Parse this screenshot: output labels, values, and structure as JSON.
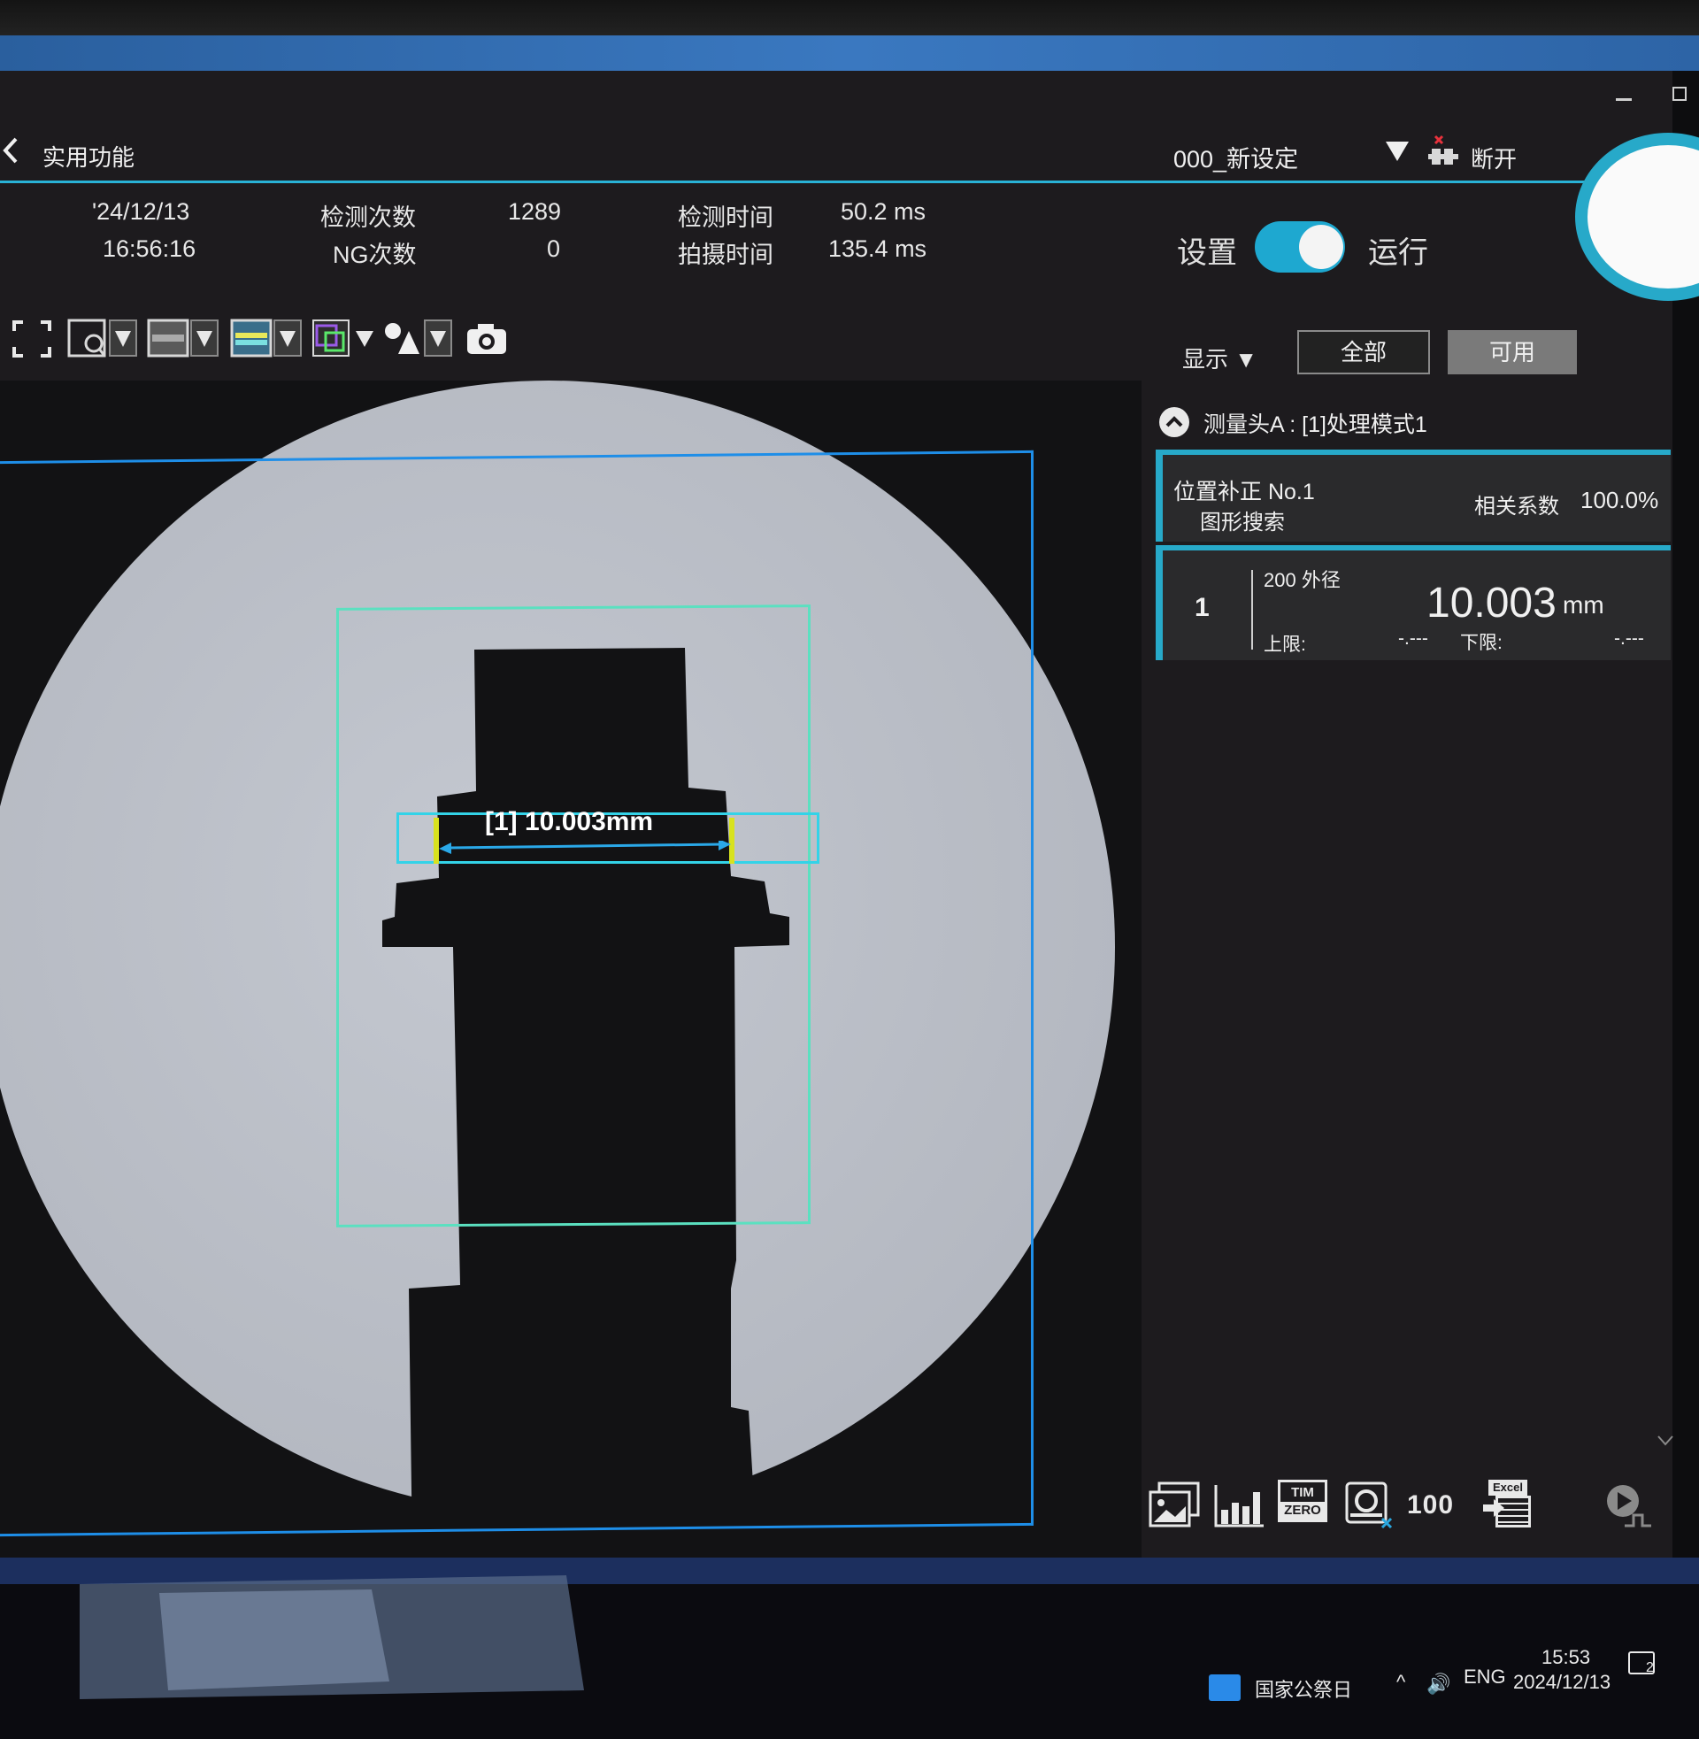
{
  "app": {
    "menu_title": "实用功能",
    "program_name": "000_新设定",
    "disconnect_label": "断开"
  },
  "status": {
    "date": "'24/12/13",
    "time": "16:56:16",
    "inspection_count_label": "检测次数",
    "inspection_count_value": "1289",
    "ng_count_label": "NG次数",
    "ng_count_value": "0",
    "inspection_time_label": "检测时间",
    "inspection_time_value": "50.2 ms",
    "capture_time_label": "拍摄时间",
    "capture_time_value": "135.4 ms"
  },
  "mode": {
    "setup_label": "设置",
    "run_label": "运行",
    "run_enabled": true
  },
  "panel": {
    "display_menu": "显示",
    "all_button": "全部",
    "enabled_button": "可用",
    "head_label": "测量头A : [1]处理模式1",
    "position_tool": {
      "title": "位置补正 No.1",
      "subtitle": "图形搜索",
      "corr_label": "相关系数",
      "corr_value": "100.0%"
    },
    "measurement": {
      "index": "1",
      "name": "200 外径",
      "value": "10.003",
      "unit": "mm",
      "upper_label": "上限:",
      "upper_value": "-.---",
      "lower_label": "下限:",
      "lower_value": "-.---"
    }
  },
  "overlay": {
    "measure_text": "[1]  10.003mm"
  },
  "bottom_icons": {
    "tim_zero_top": "TIM",
    "tim_zero_bottom": "ZERO",
    "counter_text": "100",
    "excel_label": "Excel"
  },
  "taskbar": {
    "holiday_text": "国家公祭日",
    "lang": "ENG",
    "clock_time": "15:53",
    "clock_date": "2024/12/13",
    "notification_count": "2"
  },
  "colors": {
    "accent": "#27a9c9",
    "roi_outer": "#1e8ee8",
    "roi_inner": "#5be0c0",
    "roi_measure": "#33d3e8",
    "edge_marker": "#d8e21e"
  }
}
